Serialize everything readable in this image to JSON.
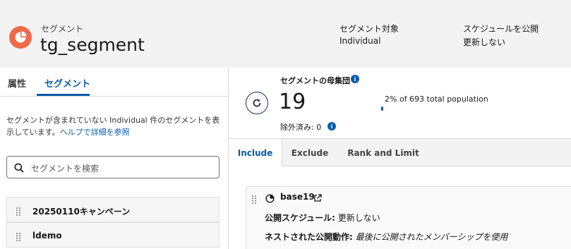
{
  "header": {
    "object_type": "セグメント",
    "title": "tg_segment",
    "fields": [
      {
        "label": "セグメント対象",
        "value": "Individual"
      },
      {
        "label": "スケジュールを公開",
        "value": "更新しない"
      }
    ]
  },
  "left_panel": {
    "tabs": [
      {
        "label": "属性"
      },
      {
        "label": "セグメント"
      }
    ],
    "info_text": "セグメントが含まれていない Individual 件のセグメントを表示しています。",
    "help_link": "ヘルプで詳細を参照",
    "search": {
      "placeholder": "セグメントを検索"
    },
    "segments": [
      {
        "label": "20250110キャンペーン"
      },
      {
        "label": "ldemo"
      }
    ]
  },
  "population": {
    "label": "セグメントの母集団",
    "count": "19",
    "excluded": "除外済み: 0",
    "percent_text": "2% of 693 total population",
    "percent_value": 0.02
  },
  "right_tabs": [
    {
      "label": "Include"
    },
    {
      "label": "Exclude"
    },
    {
      "label": "Rank and Limit"
    }
  ],
  "criteria_card": {
    "title": "base19",
    "publish_schedule_label": "公開スケジュール:",
    "publish_schedule_value": "更新しない",
    "nested_label": "ネストされた公開動作:",
    "nested_value": "最後に公開されたメンバーシップを使用"
  },
  "colors": {
    "accent": "#0b5cab",
    "logo": "#ee6a4b"
  }
}
